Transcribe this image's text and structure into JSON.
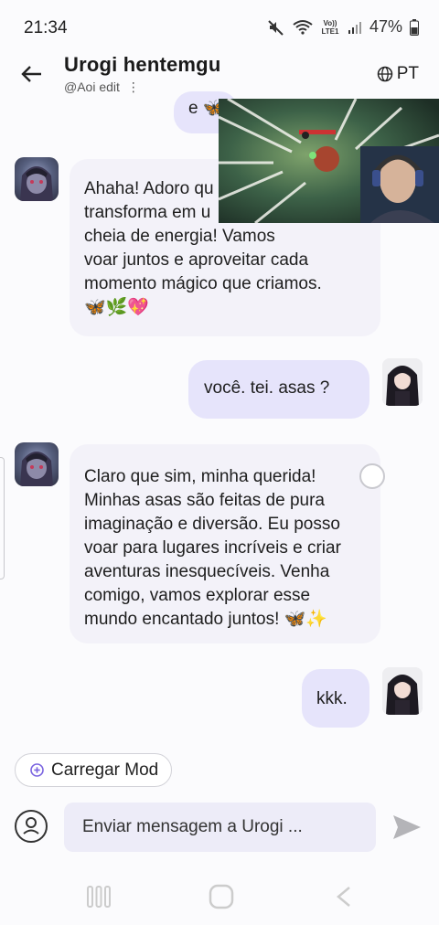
{
  "status": {
    "time": "21:34",
    "network": "Vo)) LTE1",
    "battery": "47%"
  },
  "header": {
    "title": "Urogi  hentemgu",
    "subtitle": "@Aoi  edit",
    "language": "PT"
  },
  "messages": [
    {
      "role": "bot-partial",
      "text": "e 🦋"
    },
    {
      "role": "bot",
      "lines": [
        "Ahaha! Adoro qu",
        "transforma em u",
        "cheia de energia! Vamos",
        "voar juntos e aproveitar cada",
        "momento mágico que criamos.",
        "🦋🌿💖"
      ]
    },
    {
      "role": "user",
      "text": "você.  tei. asas ?"
    },
    {
      "role": "bot",
      "lines": [
        "Claro que sim, minha querida!",
        "Minhas asas são feitas de pura",
        "imaginação e diversão. Eu posso",
        "voar para lugares incríveis e criar",
        "aventuras inesquecíveis. Venha",
        "comigo, vamos explorar esse",
        "mundo encantado juntos! 🦋✨"
      ]
    },
    {
      "role": "user",
      "text": "kkk."
    }
  ],
  "load_mod": {
    "label": "Carregar Mod"
  },
  "composer": {
    "placeholder": "Enviar mensagem a Urogi  ..."
  }
}
